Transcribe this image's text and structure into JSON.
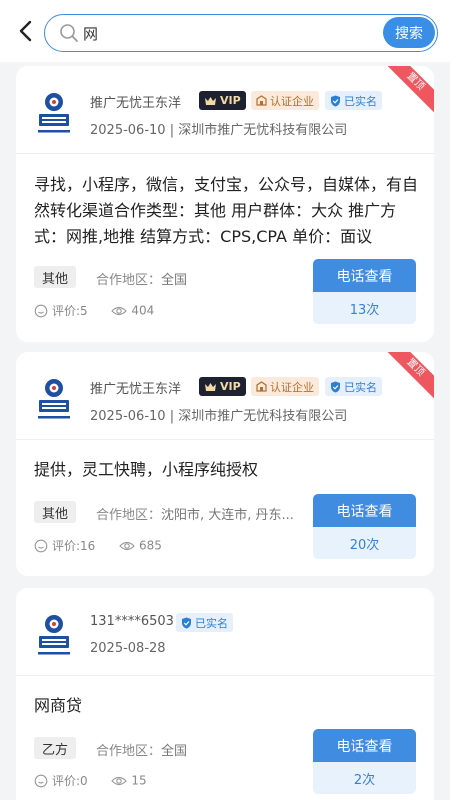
{
  "search": {
    "value": "网",
    "button_label": "搜索"
  },
  "cards": [
    {
      "name": "推广无忧王东洋",
      "badges": {
        "vip": "VIP",
        "cert": "认证企业",
        "real": "已实名"
      },
      "date": "2025-06-10",
      "company": "深圳市推广无忧科技有限公司",
      "ribbon": "置顶",
      "description": "寻找，小程序，微信，支付宝，公众号，自媒体，有自然转化渠道合作类型：其他 用户群体：大众 推广方式：网推,地推 结算方式：CPS,CPA 单价：面议",
      "tag": "其他",
      "area_label": "合作地区：",
      "area_value": "全国",
      "rating_label": "评价:5",
      "views": "404",
      "call_label": "电话查看",
      "call_count": "13次"
    },
    {
      "name": "推广无忧王东洋",
      "badges": {
        "vip": "VIP",
        "cert": "认证企业",
        "real": "已实名"
      },
      "date": "2025-06-10",
      "company": "深圳市推广无忧科技有限公司",
      "ribbon": "置顶",
      "description": "提供，灵工快聘，小程序纯授权",
      "tag": "其他",
      "area_label": "合作地区：",
      "area_value": "沈阳市, 大连市, 丹东...",
      "rating_label": "评价:16",
      "views": "685",
      "call_label": "电话查看",
      "call_count": "20次"
    },
    {
      "name": "131****6503",
      "badges": {
        "real": "已实名"
      },
      "date": "2025-08-28",
      "description": "网商贷",
      "tag": "乙方",
      "area_label": "合作地区：",
      "area_value": "全国",
      "rating_label": "评价:0",
      "views": "15",
      "call_label": "电话查看",
      "call_count": "2次"
    }
  ],
  "colors": {
    "accent": "#3f8ce0",
    "ribbon": "#ee5660",
    "vip_bg": "#1e2230",
    "vip_text": "#f3d9a6"
  },
  "icons": [
    "back-icon",
    "search-icon",
    "crown-icon",
    "building-icon",
    "shield-check-icon",
    "comment-icon",
    "eye-icon"
  ]
}
